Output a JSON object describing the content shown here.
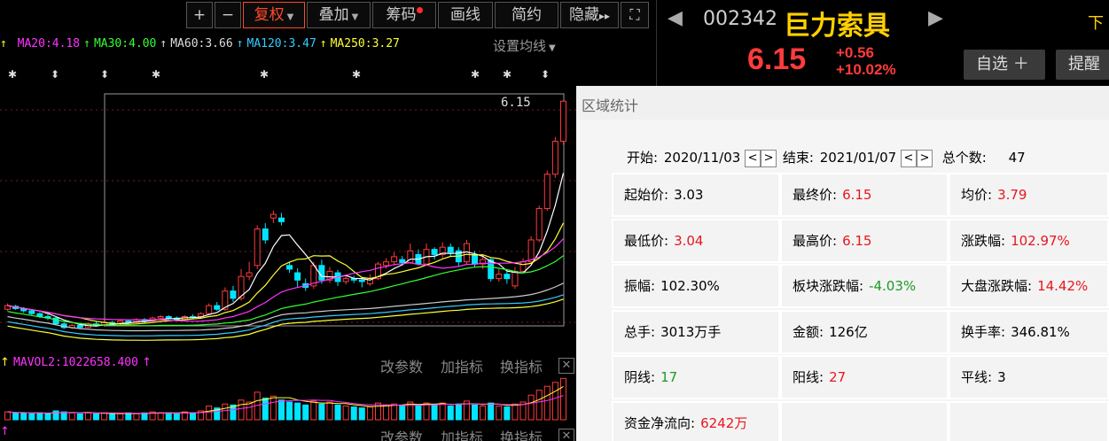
{
  "toolbar": {
    "plus": "+",
    "minus": "−",
    "restore_rights": "复权",
    "overlay": "叠加",
    "chips": "筹码",
    "draw_line": "画线",
    "simple": "简约",
    "hide": "隐藏",
    "hide_arrows": "▸▸",
    "fullscreen_icon": "⛶"
  },
  "ma_line": {
    "items": [
      {
        "label": "MA20:4.18",
        "color": "#ff33ff"
      },
      {
        "label": "MA30:4.00",
        "color": "#33ff33"
      },
      {
        "label": "MA60:3.66",
        "color": "#dddddd"
      },
      {
        "label": "MA120:3.47",
        "color": "#33ccff"
      },
      {
        "label": "MA250:3.27",
        "color": "#ffff33"
      }
    ],
    "settings": "设置均线"
  },
  "chart_data": {
    "type": "candlestick",
    "last_price_label": "6.15",
    "candles": [
      {
        "o": 3.3,
        "c": 3.35,
        "h": 3.38,
        "l": 3.28
      },
      {
        "o": 3.34,
        "c": 3.31,
        "h": 3.36,
        "l": 3.29
      },
      {
        "o": 3.31,
        "c": 3.28,
        "h": 3.33,
        "l": 3.25
      },
      {
        "o": 3.28,
        "c": 3.24,
        "h": 3.3,
        "l": 3.22
      },
      {
        "o": 3.24,
        "c": 3.2,
        "h": 3.26,
        "l": 3.18
      },
      {
        "o": 3.2,
        "c": 3.18,
        "h": 3.23,
        "l": 3.15
      },
      {
        "o": 3.18,
        "c": 3.1,
        "h": 3.2,
        "l": 3.08
      },
      {
        "o": 3.1,
        "c": 3.05,
        "h": 3.12,
        "l": 3.03
      },
      {
        "o": 3.05,
        "c": 3.08,
        "h": 3.1,
        "l": 3.03
      },
      {
        "o": 3.08,
        "c": 3.05,
        "h": 3.1,
        "l": 3.03
      },
      {
        "o": 3.05,
        "c": 3.1,
        "h": 3.12,
        "l": 3.04
      },
      {
        "o": 3.1,
        "c": 3.08,
        "h": 3.13,
        "l": 3.06
      },
      {
        "o": 3.08,
        "c": 3.12,
        "h": 3.15,
        "l": 3.06
      },
      {
        "o": 3.12,
        "c": 3.1,
        "h": 3.14,
        "l": 3.08
      },
      {
        "o": 3.1,
        "c": 3.14,
        "h": 3.16,
        "l": 3.08
      },
      {
        "o": 3.14,
        "c": 3.12,
        "h": 3.16,
        "l": 3.1
      },
      {
        "o": 3.12,
        "c": 3.16,
        "h": 3.18,
        "l": 3.1
      },
      {
        "o": 3.16,
        "c": 3.14,
        "h": 3.18,
        "l": 3.12
      },
      {
        "o": 3.14,
        "c": 3.18,
        "h": 3.2,
        "l": 3.12
      },
      {
        "o": 3.18,
        "c": 3.2,
        "h": 3.22,
        "l": 3.15
      },
      {
        "o": 3.2,
        "c": 3.18,
        "h": 3.22,
        "l": 3.16
      },
      {
        "o": 3.18,
        "c": 3.16,
        "h": 3.2,
        "l": 3.14
      },
      {
        "o": 3.16,
        "c": 3.2,
        "h": 3.22,
        "l": 3.14
      },
      {
        "o": 3.2,
        "c": 3.19,
        "h": 3.23,
        "l": 3.17
      },
      {
        "o": 3.2,
        "c": 3.24,
        "h": 3.26,
        "l": 3.18
      },
      {
        "o": 3.24,
        "c": 3.35,
        "h": 3.38,
        "l": 3.22
      },
      {
        "o": 3.35,
        "c": 3.3,
        "h": 3.4,
        "l": 3.28
      },
      {
        "o": 3.3,
        "c": 3.55,
        "h": 3.6,
        "l": 3.28
      },
      {
        "o": 3.55,
        "c": 3.45,
        "h": 3.62,
        "l": 3.4
      },
      {
        "o": 3.45,
        "c": 3.75,
        "h": 3.85,
        "l": 3.42
      },
      {
        "o": 3.75,
        "c": 3.8,
        "h": 3.95,
        "l": 3.7
      },
      {
        "o": 3.9,
        "c": 4.4,
        "h": 4.45,
        "l": 3.85
      },
      {
        "o": 4.4,
        "c": 4.25,
        "h": 4.48,
        "l": 4.2
      },
      {
        "o": 4.55,
        "c": 4.6,
        "h": 4.65,
        "l": 4.48
      },
      {
        "o": 4.55,
        "c": 4.5,
        "h": 4.62,
        "l": 4.45
      },
      {
        "o": 3.9,
        "c": 3.85,
        "h": 3.95,
        "l": 3.8
      },
      {
        "o": 3.8,
        "c": 3.7,
        "h": 3.86,
        "l": 3.6
      },
      {
        "o": 3.65,
        "c": 3.6,
        "h": 3.72,
        "l": 3.55
      },
      {
        "o": 3.62,
        "c": 3.9,
        "h": 3.95,
        "l": 3.58
      },
      {
        "o": 3.9,
        "c": 3.7,
        "h": 3.98,
        "l": 3.65
      },
      {
        "o": 3.7,
        "c": 3.82,
        "h": 3.88,
        "l": 3.66
      },
      {
        "o": 3.8,
        "c": 3.68,
        "h": 3.84,
        "l": 3.62
      },
      {
        "o": 3.68,
        "c": 3.72,
        "h": 3.76,
        "l": 3.64
      },
      {
        "o": 3.72,
        "c": 3.7,
        "h": 3.76,
        "l": 3.66
      },
      {
        "o": 3.7,
        "c": 3.68,
        "h": 3.74,
        "l": 3.6
      },
      {
        "o": 3.65,
        "c": 3.72,
        "h": 3.78,
        "l": 3.62
      },
      {
        "o": 3.72,
        "c": 3.92,
        "h": 3.95,
        "l": 3.7
      },
      {
        "o": 3.9,
        "c": 3.95,
        "h": 4.0,
        "l": 3.86
      },
      {
        "o": 3.95,
        "c": 4.02,
        "h": 4.08,
        "l": 3.9
      },
      {
        "o": 3.98,
        "c": 3.94,
        "h": 4.03,
        "l": 3.9
      },
      {
        "o": 3.94,
        "c": 4.1,
        "h": 4.2,
        "l": 3.92
      },
      {
        "o": 4.05,
        "c": 3.92,
        "h": 4.12,
        "l": 3.9
      },
      {
        "o": 3.92,
        "c": 4.12,
        "h": 4.2,
        "l": 3.9
      },
      {
        "o": 4.12,
        "c": 4.05,
        "h": 4.15,
        "l": 3.98
      },
      {
        "o": 4.05,
        "c": 4.15,
        "h": 4.22,
        "l": 4.0
      },
      {
        "o": 4.15,
        "c": 4.08,
        "h": 4.2,
        "l": 4.02
      },
      {
        "o": 4.1,
        "c": 3.95,
        "h": 4.15,
        "l": 3.88
      },
      {
        "o": 3.95,
        "c": 4.2,
        "h": 4.25,
        "l": 3.92
      },
      {
        "o": 4.05,
        "c": 3.92,
        "h": 4.1,
        "l": 3.88
      },
      {
        "o": 3.92,
        "c": 3.98,
        "h": 4.05,
        "l": 3.85
      },
      {
        "o": 3.98,
        "c": 3.72,
        "h": 4.0,
        "l": 3.68
      },
      {
        "o": 3.72,
        "c": 3.78,
        "h": 3.85,
        "l": 3.68
      },
      {
        "o": 3.78,
        "c": 3.72,
        "h": 3.82,
        "l": 3.65
      },
      {
        "o": 3.62,
        "c": 3.82,
        "h": 3.88,
        "l": 3.58
      },
      {
        "o": 3.82,
        "c": 3.95,
        "h": 4.0,
        "l": 3.8
      },
      {
        "o": 3.95,
        "c": 4.25,
        "h": 4.3,
        "l": 3.92
      },
      {
        "o": 4.25,
        "c": 4.68,
        "h": 4.72,
        "l": 4.22
      },
      {
        "o": 4.68,
        "c": 5.15,
        "h": 5.2,
        "l": 4.65
      },
      {
        "o": 5.15,
        "c": 5.6,
        "h": 5.66,
        "l": 5.1
      },
      {
        "o": 5.6,
        "c": 6.15,
        "h": 6.16,
        "l": 5.55
      }
    ],
    "ylim": [
      3.0,
      6.25
    ],
    "volumes": [
      8,
      7,
      7,
      6,
      7,
      6,
      9,
      8,
      7,
      6,
      7,
      6,
      7,
      6,
      6,
      7,
      6,
      7,
      8,
      7,
      7,
      6,
      8,
      7,
      9,
      14,
      12,
      16,
      15,
      20,
      18,
      28,
      22,
      24,
      20,
      18,
      17,
      15,
      19,
      16,
      18,
      15,
      14,
      13,
      12,
      13,
      17,
      15,
      16,
      14,
      18,
      15,
      17,
      15,
      17,
      14,
      16,
      19,
      15,
      14,
      17,
      14,
      13,
      16,
      18,
      25,
      30,
      34,
      38,
      42
    ],
    "vol_ylim": [
      0,
      45
    ]
  },
  "vol_header": {
    "mavol2": "MAVOL2:1022658.400",
    "modify_params": "改参数",
    "add_indicator": "加指标",
    "change_indicator": "换指标",
    "close": "✕"
  },
  "stock": {
    "prev_icon": "◀",
    "code": "002342",
    "name": "巨力索具",
    "next_icon": "▶",
    "next_label": "下",
    "price": "6.15",
    "change": "+0.56",
    "change_pct": "+10.02%",
    "add_watch": "自选 ＋",
    "alert": "提醒 ..."
  },
  "stats": {
    "title": "区域统计",
    "start_label": "开始:",
    "start_date": "2020/11/03",
    "end_label": "结束:",
    "end_date": "2021/01/07",
    "count_label": "总个数:",
    "count": "47",
    "prev_btn": "<",
    "next_btn": ">",
    "cells": [
      {
        "k": "起始价:",
        "v": "3.03",
        "c": "v-black"
      },
      {
        "k": "最终价:",
        "v": "6.15",
        "c": "v-red"
      },
      {
        "k": "均价:",
        "v": "3.79",
        "c": "v-red"
      },
      {
        "k": "最低价:",
        "v": "3.04",
        "c": "v-red"
      },
      {
        "k": "最高价:",
        "v": "6.15",
        "c": "v-red"
      },
      {
        "k": "涨跌幅:",
        "v": "102.97%",
        "c": "v-red"
      },
      {
        "k": "振幅:",
        "v": "102.30%",
        "c": "v-black"
      },
      {
        "k": "板块涨跌幅:",
        "v": "-4.03%",
        "c": "v-green"
      },
      {
        "k": "大盘涨跌幅:",
        "v": "14.42%",
        "c": "v-red"
      },
      {
        "k": "总手:",
        "v": "3013万手",
        "c": "v-black"
      },
      {
        "k": "金额:",
        "v": "126亿",
        "c": "v-black"
      },
      {
        "k": "换手率:",
        "v": "346.81%",
        "c": "v-black"
      },
      {
        "k": "阴线:",
        "v": "17",
        "c": "v-green"
      },
      {
        "k": "阳线:",
        "v": "27",
        "c": "v-red"
      },
      {
        "k": "平线:",
        "v": "3",
        "c": "v-black"
      },
      {
        "k": "资金净流向:",
        "v": "6242万",
        "c": "v-red"
      },
      {
        "k": "",
        "v": "",
        "c": "v-black"
      },
      {
        "k": "",
        "v": "",
        "c": "v-black"
      }
    ]
  }
}
